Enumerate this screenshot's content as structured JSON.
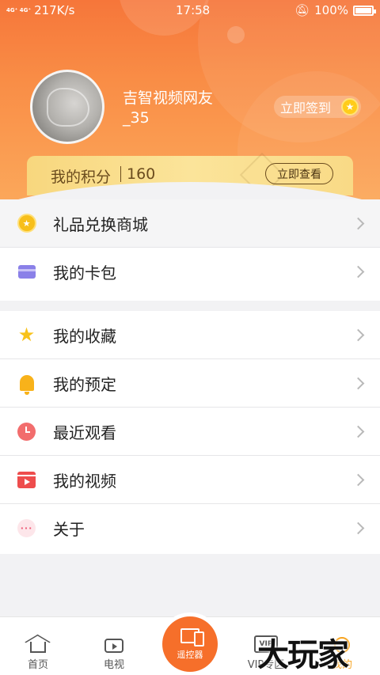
{
  "status_bar": {
    "signal": "4G⁺ 4G⁺",
    "network_speed": "217K/s",
    "time": "17:58",
    "battery": "100%"
  },
  "profile": {
    "username": "吉智视频网友_35",
    "signin_label": "立即签到"
  },
  "points": {
    "label": "我的积分",
    "value": "160",
    "view_button": "立即查看"
  },
  "menu_groups": [
    {
      "items": [
        {
          "label": "礼品兑换商城",
          "icon": "gift-coin-icon"
        },
        {
          "label": "我的卡包",
          "icon": "card-wallet-icon"
        }
      ]
    },
    {
      "items": [
        {
          "label": "我的收藏",
          "icon": "star-icon"
        },
        {
          "label": "我的预定",
          "icon": "bell-icon"
        },
        {
          "label": "最近观看",
          "icon": "clock-icon"
        },
        {
          "label": "我的视频",
          "icon": "video-icon"
        },
        {
          "label": "关于",
          "icon": "more-dots-icon"
        }
      ]
    }
  ],
  "tab_bar": {
    "tabs": [
      {
        "label": "首页",
        "icon": "home-icon"
      },
      {
        "label": "电视",
        "icon": "tv-icon"
      },
      {
        "label": "遥控器",
        "icon": "remote-icon"
      },
      {
        "label": "VIP专区",
        "icon": "vip-icon"
      },
      {
        "label": "我的",
        "icon": "profile-icon"
      }
    ],
    "active_index": 4
  },
  "watermark": "大玩家",
  "colors": {
    "header_orange": "#f6763a",
    "accent_orange": "#f66f2a",
    "active_tab": "#f7a21b",
    "points_gold": "#f8d77e"
  }
}
